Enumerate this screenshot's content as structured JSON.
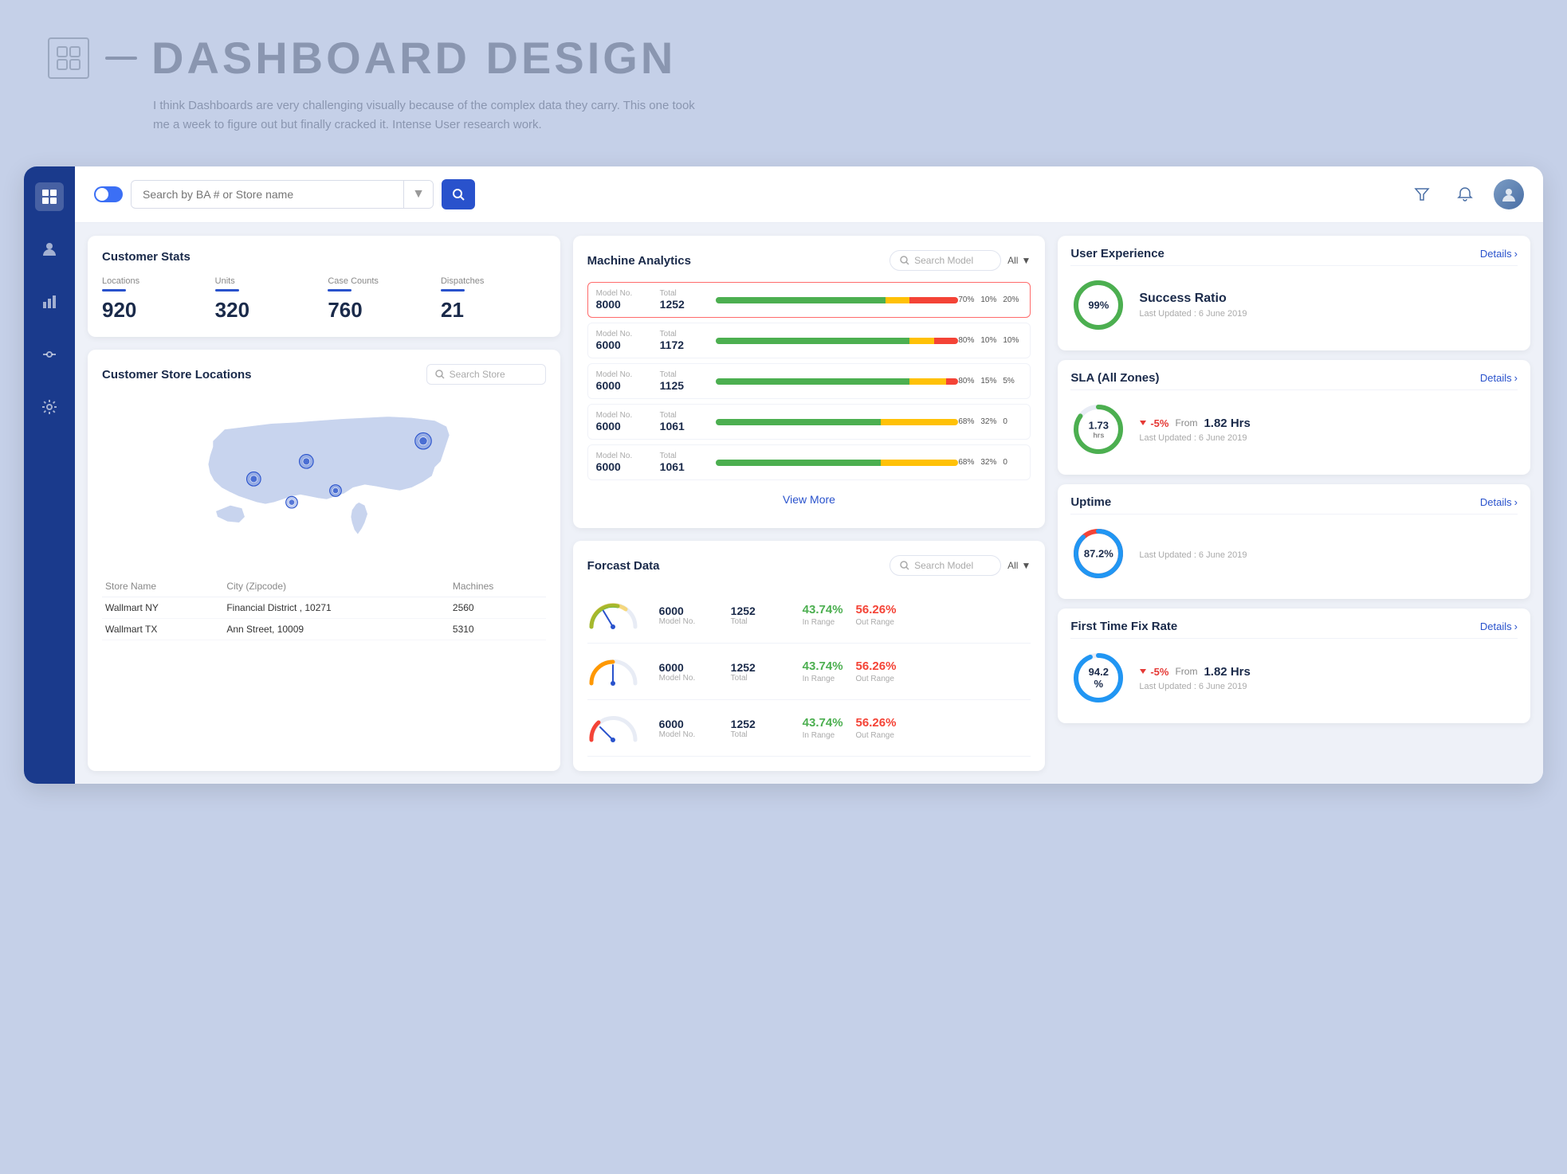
{
  "header": {
    "title": "DASHBOARD DESIGN",
    "subtitle": "I think Dashboards are very challenging visually because of the complex data they carry. This one took me a week to figure out but finally cracked it. Intense User research work.",
    "title_line": "—"
  },
  "topbar": {
    "search_placeholder": "Search by BA # or Store name",
    "search_button_label": "🔍"
  },
  "sidebar": {
    "items": [
      {
        "icon": "⊞",
        "label": "grid-icon",
        "active": true
      },
      {
        "icon": "👤",
        "label": "user-icon",
        "active": false
      },
      {
        "icon": "📊",
        "label": "chart-icon",
        "active": false
      },
      {
        "icon": "🔗",
        "label": "link-icon",
        "active": false
      },
      {
        "icon": "⚙",
        "label": "settings-icon",
        "active": false
      }
    ]
  },
  "customer_stats": {
    "title": "Customer Stats",
    "stats": [
      {
        "label": "Locations",
        "value": "920"
      },
      {
        "label": "Units",
        "value": "320"
      },
      {
        "label": "Case Counts",
        "value": "760"
      },
      {
        "label": "Dispatches",
        "value": "21"
      }
    ]
  },
  "store_locations": {
    "title": "Customer Store Locations",
    "search_placeholder": "Search Store",
    "table_headers": [
      "Store Name",
      "City (Zipcode)",
      "Machines"
    ],
    "rows": [
      {
        "store": "Wallmart NY",
        "city": "Financial District , 10271",
        "machines": "2560"
      },
      {
        "store": "Wallmart TX",
        "city": "Ann Street, 10009",
        "machines": "5310"
      }
    ]
  },
  "machine_analytics": {
    "title": "Machine Analytics",
    "search_placeholder": "Search Model",
    "filter_label": "All",
    "rows": [
      {
        "model_label": "Model No.",
        "model": "8000",
        "total_label": "Total",
        "total": "1252",
        "green": 70,
        "yellow": 10,
        "red": 20,
        "pcts": [
          "70%",
          "10%",
          "20%"
        ],
        "highlighted": true
      },
      {
        "model_label": "Model No.",
        "model": "6000",
        "total_label": "Total",
        "total": "1172",
        "green": 80,
        "yellow": 10,
        "red": 10,
        "pcts": [
          "80%",
          "10%",
          "10%"
        ],
        "highlighted": false
      },
      {
        "model_label": "Model No.",
        "model": "6000",
        "total_label": "Total",
        "total": "1125",
        "green": 80,
        "yellow": 15,
        "red": 5,
        "pcts": [
          "80%",
          "15%",
          "5%"
        ],
        "highlighted": false
      },
      {
        "model_label": "Model No.",
        "model": "6000",
        "total_label": "Total",
        "total": "1061",
        "green": 68,
        "yellow": 32,
        "red": 0,
        "pcts": [
          "68%",
          "32%",
          "0"
        ],
        "highlighted": false
      },
      {
        "model_label": "Model No.",
        "model": "6000",
        "total_label": "Total",
        "total": "1061",
        "green": 68,
        "yellow": 32,
        "red": 0,
        "pcts": [
          "68%",
          "32%",
          "0"
        ],
        "highlighted": false
      }
    ],
    "view_more": "View More"
  },
  "forecast_data": {
    "title": "Forcast Data",
    "search_placeholder": "Search Model",
    "filter_label": "All",
    "rows": [
      {
        "model": "6000",
        "model_label": "Model No.",
        "total": "1252",
        "total_label": "Total",
        "in_range": "43.74%",
        "in_range_label": "In Range",
        "out_range": "56.26%",
        "out_range_label": "Out Range",
        "gauge_color": "green"
      },
      {
        "model": "6000",
        "model_label": "Model No.",
        "total": "1252",
        "total_label": "Total",
        "in_range": "43.74%",
        "in_range_label": "In Range",
        "out_range": "56.26%",
        "out_range_label": "Out Range",
        "gauge_color": "orange"
      },
      {
        "model": "6000",
        "model_label": "Model No.",
        "total": "1252",
        "total_label": "Total",
        "in_range": "43.74%",
        "in_range_label": "In Range",
        "out_range": "56.26%",
        "out_range_label": "Out Range",
        "gauge_color": "red"
      }
    ]
  },
  "user_experience": {
    "title": "User Experience",
    "details_label": "Details",
    "success_ratio": {
      "value": "99%",
      "label": "Success Ratio",
      "updated": "Last Updated : 6 June 2019",
      "color": "#4caf50"
    }
  },
  "sla": {
    "title": "SLA (All Zones)",
    "details_label": "Details",
    "value": "1.73",
    "unit": "hrs",
    "change": "-5%",
    "from_label": "From",
    "from_value": "1.82 Hrs",
    "updated": "Last Updated : 6 June 2019",
    "color": "#4caf50"
  },
  "uptime": {
    "title": "Uptime",
    "details_label": "Details",
    "value": "87.2%",
    "updated": "Last Updated : 6 June 2019",
    "color_outer": "#f44336",
    "color_inner": "#2196f3"
  },
  "first_time_fix": {
    "title": "First Time Fix Rate",
    "details_label": "Details",
    "value": "94.2 %",
    "change": "-5%",
    "from_label": "From",
    "from_value": "1.82 Hrs",
    "updated": "Last Updated : 6 June 2019",
    "color": "#2196f3"
  },
  "last_updated": "Last Updated June 2019"
}
